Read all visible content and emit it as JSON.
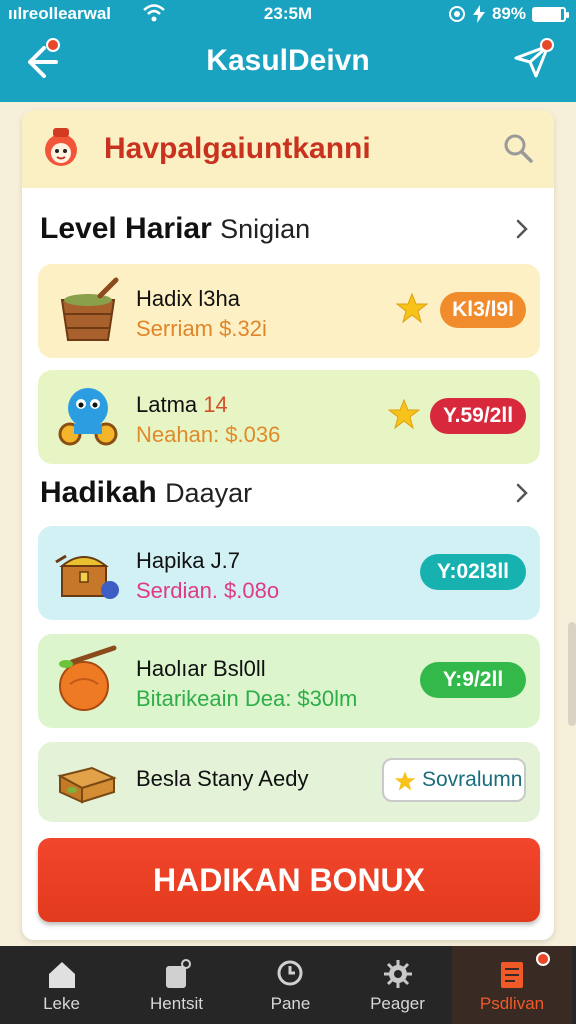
{
  "status_bar": {
    "carrier": "ıılreollearwal",
    "time": "23:5M",
    "battery": "89%",
    "battery_level": 0.89
  },
  "app_bar": {
    "title": "KasulDeivn",
    "back_icon": "arrow-left-icon",
    "share_icon": "send-icon"
  },
  "header": {
    "title": "Havpalgaiuntkanni",
    "search_icon": "search-icon"
  },
  "sections": [
    {
      "title": "Level Hariar",
      "subtitle": "Snigian"
    },
    {
      "title": "Hadikah",
      "subtitle": "Daayar"
    }
  ],
  "rows": [
    {
      "name": "Hadix",
      "name_extra": "l3ha",
      "sub": "Serriam $.32i",
      "badge": "Kl3/l9l",
      "color": "#f08c2c",
      "bg": "#fdf0c4",
      "sub_color": "#e0862a"
    },
    {
      "name": "Latma",
      "name_extra": "14",
      "sub": "Neahan: $.036",
      "badge": "Y.59/2ll",
      "color": "#d8283c",
      "bg": "#e7f5c5",
      "sub_color": "#e08a2a"
    },
    {
      "name": "Hapika",
      "name_extra": "J.7",
      "sub": "Serdian. $.08o",
      "badge": "Y:02l3ll",
      "color": "#17b2b0",
      "bg": "#d1f1f4",
      "sub_color": "#e03a86"
    },
    {
      "name": "Haolıar",
      "name_extra": "Bsl0ll",
      "sub": "Bitarikeain Dea: $30lm",
      "badge": "Y:9/2ll",
      "color": "#33b94a",
      "bg": "#dcf5cc",
      "sub_color": "#2eae48"
    },
    {
      "name": "Besla Stany Aedy",
      "name_extra": "",
      "sub": "",
      "badge": "Sovralumn",
      "color": "#1a6d7d",
      "bg": "#e4f3d8",
      "sub_color": "#111"
    }
  ],
  "cta": {
    "label": "HADIKAN BONUX"
  },
  "nav": [
    {
      "label": "Leke",
      "icon": "home-icon"
    },
    {
      "label": "Hentsit",
      "icon": "tag-icon"
    },
    {
      "label": "Pane",
      "icon": "search-icon"
    },
    {
      "label": "Peager",
      "icon": "gear-icon"
    },
    {
      "label": "Psdlivan",
      "icon": "document-icon"
    }
  ]
}
